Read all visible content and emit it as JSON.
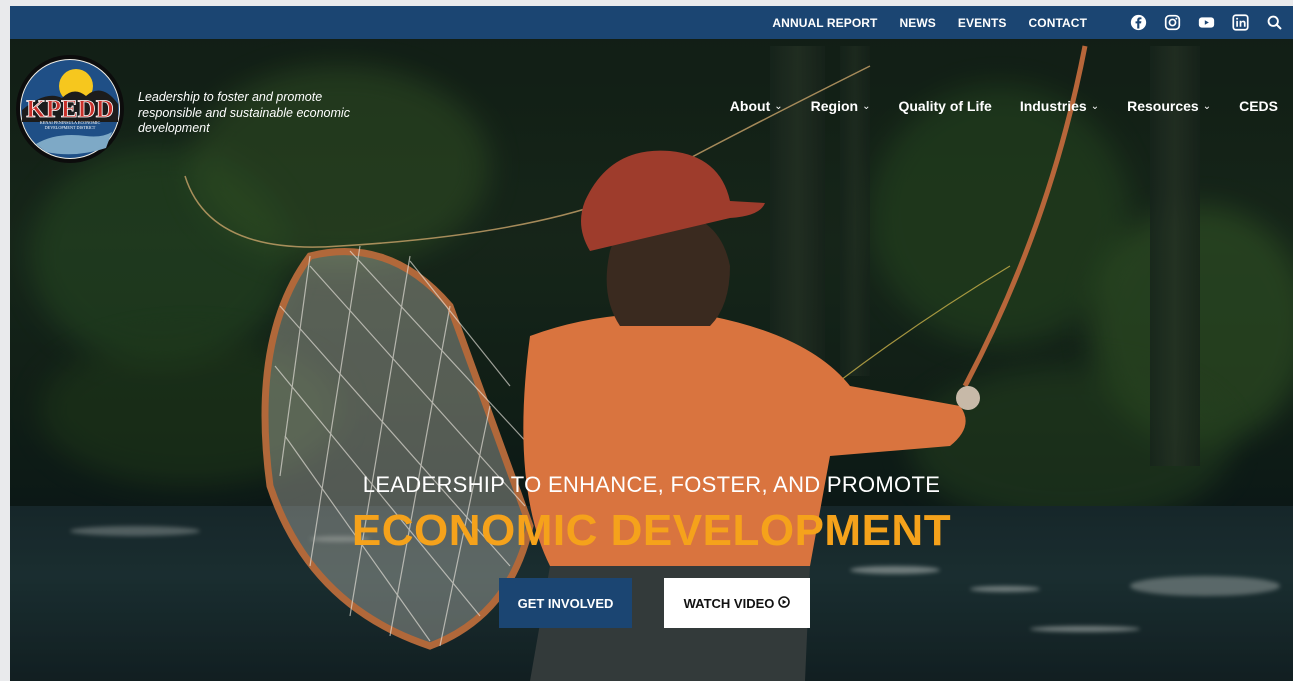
{
  "topbar": {
    "links": [
      "ANNUAL REPORT",
      "NEWS",
      "EVENTS",
      "CONTACT"
    ],
    "social_icons": [
      "facebook-icon",
      "instagram-icon",
      "youtube-icon",
      "linkedin-icon",
      "search-icon"
    ]
  },
  "header": {
    "logo_text": "KPEDD",
    "logo_subtext": "KENAI PENINSULA ECONOMIC DEVELOPMENT DISTRICT",
    "tagline": "Leadership to foster and promote responsible and sustainable economic development"
  },
  "nav": {
    "items": [
      {
        "label": "About",
        "dropdown": true
      },
      {
        "label": "Region",
        "dropdown": true
      },
      {
        "label": "Quality of Life",
        "dropdown": false
      },
      {
        "label": "Industries",
        "dropdown": true
      },
      {
        "label": "Resources",
        "dropdown": true
      },
      {
        "label": "CEDS",
        "dropdown": false
      }
    ],
    "chevron": "⌄"
  },
  "hero": {
    "kicker": "LEADERSHIP TO ENHANCE, FOSTER, AND PROMOTE",
    "headline": "ECONOMIC DEVELOPMENT",
    "primary_button": "GET INVOLVED",
    "secondary_button": "WATCH VIDEO",
    "play_icon": "play-circle-icon"
  },
  "colors": {
    "brand_blue": "#1b4572",
    "accent_orange": "#f5a21b"
  }
}
